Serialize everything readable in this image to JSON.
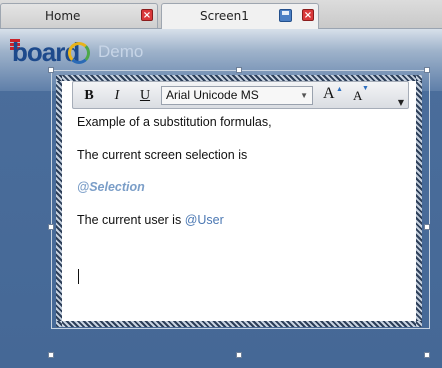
{
  "tabs": [
    {
      "label": "Home",
      "active": false
    },
    {
      "label": "Screen1",
      "active": true
    }
  ],
  "header": {
    "logo_text": "board",
    "demo_label": "Demo"
  },
  "toolbar": {
    "bold_label": "B",
    "italic_label": "I",
    "underline_label": "U",
    "font_name": "Arial Unicode MS",
    "grow_label": "A",
    "shrink_label": "A"
  },
  "editor": {
    "line1": "Example of a substitution formulas,",
    "line2": "The current screen selection is",
    "selection_field": "@Selection",
    "user_prefix": "The current user is ",
    "user_field": "@User"
  },
  "colors": {
    "accent": "#4b78b3",
    "close": "#d9383a",
    "background": "#4a6d9b"
  }
}
